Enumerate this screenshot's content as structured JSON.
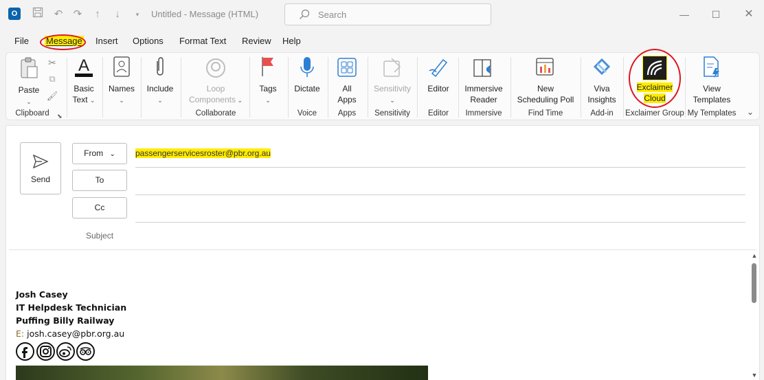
{
  "window": {
    "title": "Untitled  -  Message (HTML)",
    "search_placeholder": "Search",
    "app_icon_letter": "O"
  },
  "menu": {
    "tabs": [
      "File",
      "Message",
      "Insert",
      "Options",
      "Format Text",
      "Review",
      "Help"
    ],
    "active": "Message"
  },
  "ribbon": {
    "buttons": {
      "paste": "Paste",
      "basic_text": "Basic Text",
      "names": "Names",
      "include": "Include",
      "loop": "Loop Components",
      "tags": "Tags",
      "dictate": "Dictate",
      "all_apps_1": "All",
      "all_apps_2": "Apps",
      "sensitivity": "Sensitivity",
      "editor": "Editor",
      "immersive_1": "Immersive",
      "immersive_2": "Reader",
      "poll_1": "New",
      "poll_2": "Scheduling Poll",
      "viva_1": "Viva",
      "viva_2": "Insights",
      "exclaimer_1": "Exclaimer",
      "exclaimer_2": "Cloud",
      "templates_1": "View",
      "templates_2": "Templates"
    },
    "groups": {
      "clipboard": "Clipboard",
      "collaborate": "Collaborate",
      "voice": "Voice",
      "apps": "Apps",
      "sensitivity": "Sensitivity",
      "editor": "Editor",
      "immersive": "Immersive",
      "find_time": "Find Time",
      "addin": "Add-in",
      "exclaimer": "Exclaimer Group",
      "my_templates": "My Templates"
    }
  },
  "compose": {
    "send": "Send",
    "from_label": "From",
    "to_label": "To",
    "cc_label": "Cc",
    "subject_label": "Subject",
    "from_value": "passengerservicesroster@pbr.org.au"
  },
  "signature": {
    "name": "Josh Casey",
    "title": "IT Helpdesk Technician",
    "company": "Puffing Billy Railway",
    "email_label": "E:",
    "email": "josh.casey@pbr.org.au",
    "social_icons": [
      "facebook-icon",
      "instagram-icon",
      "weibo-icon",
      "tripadvisor-icon"
    ]
  },
  "colors": {
    "highlight": "#ffec00",
    "annotation": "#e0141e",
    "outlook_blue": "#0a64ad"
  }
}
